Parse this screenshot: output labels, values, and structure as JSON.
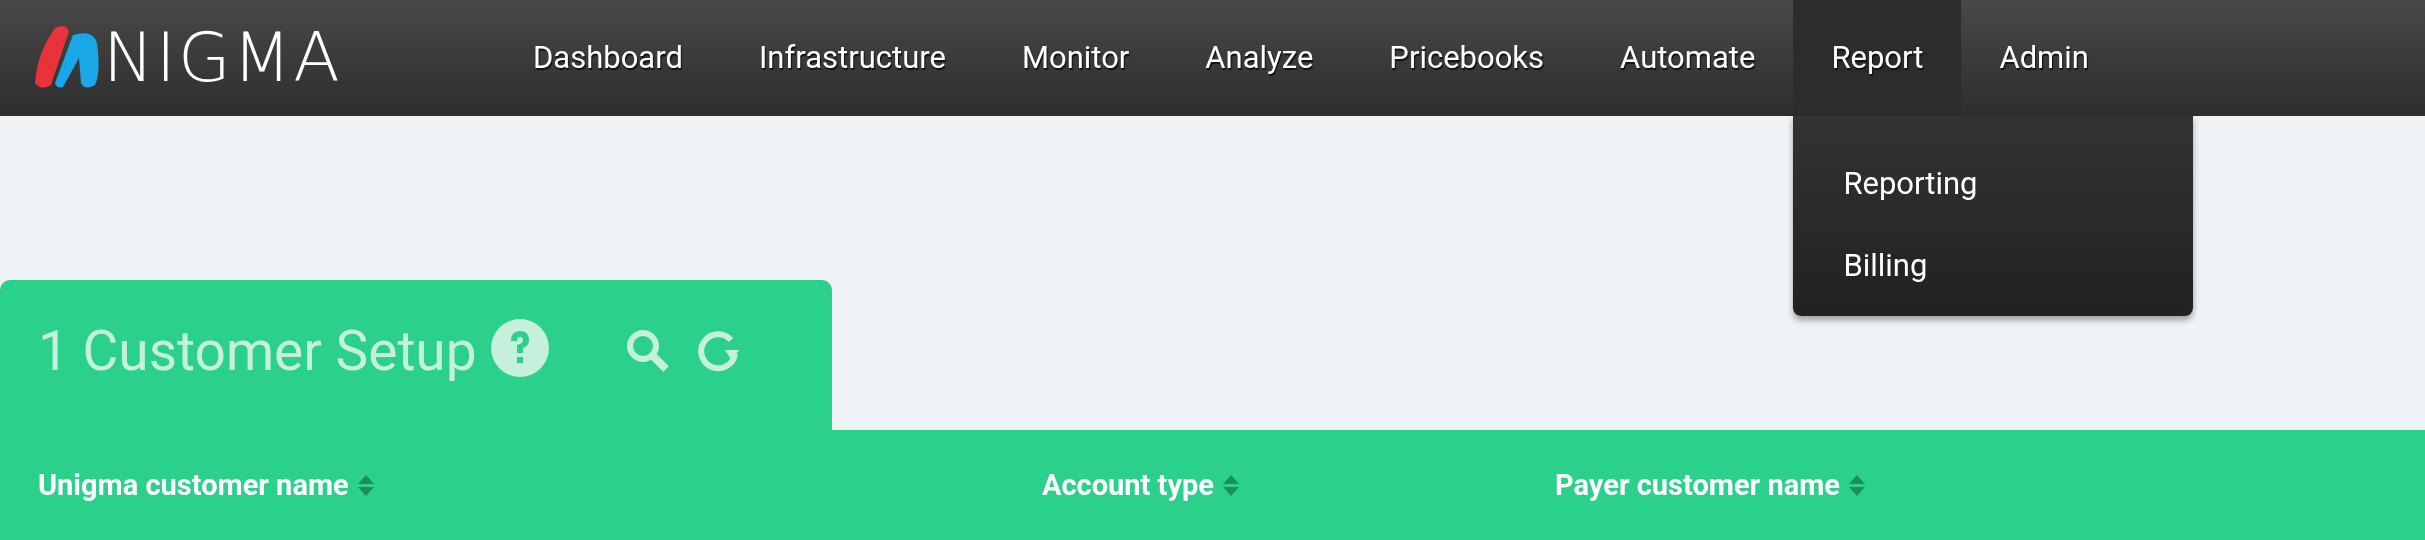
{
  "logo": {
    "text": "NIGMA"
  },
  "nav": [
    {
      "label": "Dashboard",
      "selected": false
    },
    {
      "label": "Infrastructure",
      "selected": false
    },
    {
      "label": "Monitor",
      "selected": false
    },
    {
      "label": "Analyze",
      "selected": false
    },
    {
      "label": "Pricebooks",
      "selected": false
    },
    {
      "label": "Automate",
      "selected": false
    },
    {
      "label": "Report",
      "selected": true,
      "expanded": true,
      "menu": [
        "Reporting",
        "Billing"
      ]
    },
    {
      "label": "Admin",
      "selected": false
    }
  ],
  "panel": {
    "title": "1 Customer Setup"
  },
  "table": {
    "columns": [
      "Unigma customer name",
      "Account type",
      "Payer customer name"
    ]
  }
}
